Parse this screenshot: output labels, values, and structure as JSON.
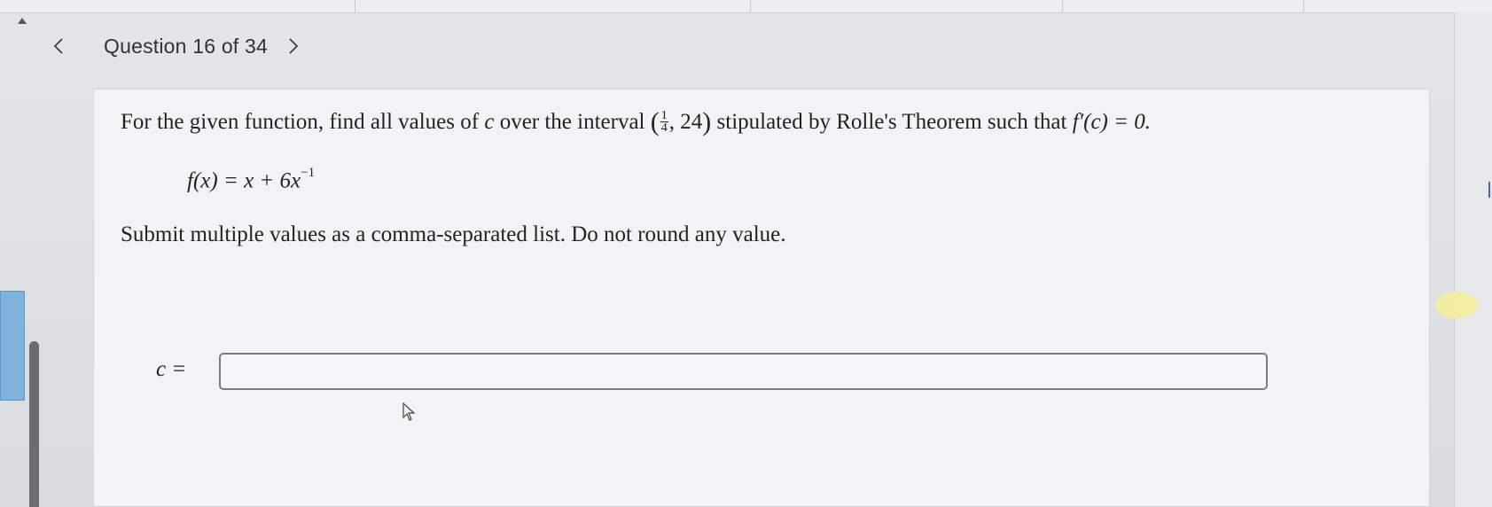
{
  "nav": {
    "title": "Question 16 of 34",
    "prev_icon": "chevron-left-icon",
    "next_icon": "chevron-right-icon"
  },
  "question": {
    "prefix": "For the given function, find all values of ",
    "var_c": "c",
    "interval_text": " over the interval ",
    "interval_num": "1",
    "interval_den": "4",
    "interval_upper": ", 24",
    "mid_text": " stipulated by Rolle's Theorem such that ",
    "condition": "f′(c) = 0.",
    "function_lhs": "f(x) = x + 6x",
    "function_exp": "−1",
    "instruction": "Submit multiple values as a comma-separated list. Do not round any value."
  },
  "answer": {
    "label": "c =",
    "value": "",
    "placeholder": ""
  },
  "colors": {
    "card_bg": "#f2f3f4",
    "text": "#222222",
    "accent_blue": "#7fb2dc"
  }
}
